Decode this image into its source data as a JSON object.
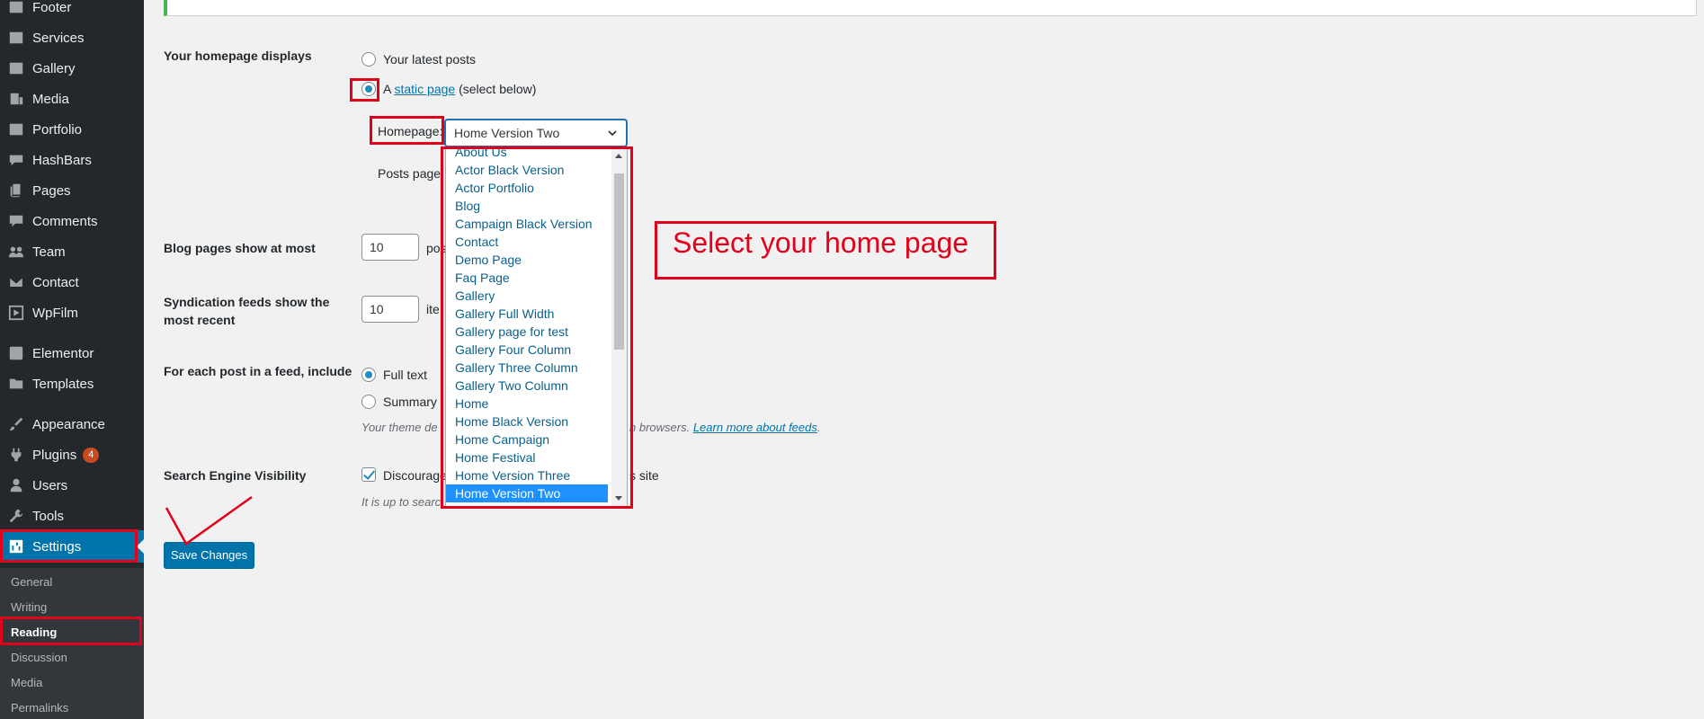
{
  "sidebar": {
    "items": [
      {
        "label": "Footer",
        "icon": "footer-icon"
      },
      {
        "label": "Services",
        "icon": "services-icon"
      },
      {
        "label": "Gallery",
        "icon": "gallery-icon"
      },
      {
        "label": "Media",
        "icon": "media-icon"
      },
      {
        "label": "Portfolio",
        "icon": "portfolio-icon"
      },
      {
        "label": "HashBars",
        "icon": "speech-bubble-icon"
      },
      {
        "label": "Pages",
        "icon": "pages-icon"
      },
      {
        "label": "Comments",
        "icon": "comments-icon"
      },
      {
        "label": "Team",
        "icon": "team-icon"
      },
      {
        "label": "Contact",
        "icon": "envelope-icon"
      },
      {
        "label": "WpFilm",
        "icon": "play-icon"
      },
      {
        "label": "Elementor",
        "icon": "elementor-icon"
      },
      {
        "label": "Templates",
        "icon": "folder-icon"
      },
      {
        "label": "Appearance",
        "icon": "paintbrush-icon"
      },
      {
        "label": "Plugins",
        "icon": "plugin-icon",
        "badge": "4"
      },
      {
        "label": "Users",
        "icon": "user-icon"
      },
      {
        "label": "Tools",
        "icon": "wrench-icon"
      },
      {
        "label": "Settings",
        "icon": "settings-icon"
      }
    ],
    "submenu": [
      "General",
      "Writing",
      "Reading",
      "Discussion",
      "Media",
      "Permalinks"
    ]
  },
  "settings": {
    "homepage_displays_label": "Your homepage displays",
    "latest_posts_label": "Your latest posts",
    "static_page_prefix": "A",
    "static_page_link": "static page",
    "static_page_suffix": "(select below)",
    "homepage_label": "Homepage:",
    "homepage_selected": "Home Version Two",
    "posts_page_label": "Posts page:",
    "blog_pages_label": "Blog pages show at most",
    "blog_pages_value": "10",
    "blog_pages_unit": "pos",
    "syndication_label_1": "Syndication feeds show the",
    "syndication_label_2": "most recent",
    "syndication_value": "10",
    "syndication_unit": "ite",
    "feed_include_label": "For each post in a feed, include",
    "full_text_label": "Full text",
    "summary_label": "Summary",
    "feed_desc_left": "Your theme de",
    "feed_desc_right": "n browsers.",
    "feed_desc_link": "Learn more about feeds",
    "search_visibility_label": "Search Engine Visibility",
    "discourage_left": "Discourage",
    "discourage_right": "s site",
    "visibility_desc": "It is up to searc",
    "save_button": "Save Changes"
  },
  "dropdown_options": [
    "About Us",
    "Actor Black Version",
    "Actor Portfolio",
    "Blog",
    "Campaign Black Version",
    "Contact",
    "Demo Page",
    "Faq Page",
    "Gallery",
    "Gallery Full Width",
    "Gallery page for test",
    "Gallery Four Column",
    "Gallery Three Column",
    "Gallery Two Column",
    "Home",
    "Home Black Version",
    "Home Campaign",
    "Home Festival",
    "Home Version Three",
    "Home Version Two"
  ],
  "annotation": {
    "callout_text": "Select your home page",
    "highlight_color": "#e2001a"
  },
  "colors": {
    "sidebar_bg": "#23282d",
    "accent": "#0073aa",
    "selected_option": "#1e90ff"
  }
}
